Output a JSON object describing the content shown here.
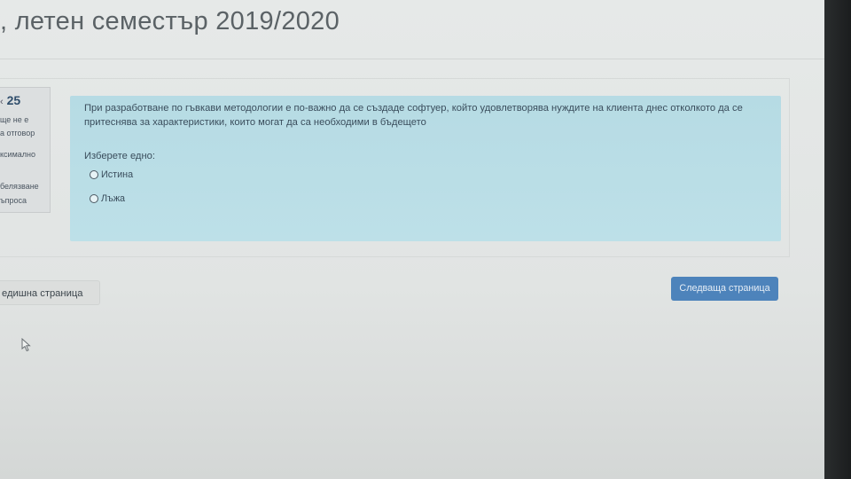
{
  "header": {
    "title": ", летен семестър 2019/2020"
  },
  "info": {
    "number_prefix": "‹",
    "number": "25",
    "lines": [
      "ще не е",
      "а отговор",
      "ксимално",
      "белязване",
      "ъпроса"
    ]
  },
  "question": {
    "text": "При разработване по гъвкави методологии е по-важно да се създаде софтуер, който удовлетворява нуждите на клиента днес отколкото да се притеснява за характеристики, които могат да са необходими в бъдещето",
    "prompt": "Изберете едно:",
    "options": [
      {
        "label": "Истина",
        "selected": false
      },
      {
        "label": "Лъжа",
        "selected": false
      }
    ]
  },
  "navigation": {
    "prev_label": "едишна страница",
    "next_label": "Следваща страница"
  },
  "colors": {
    "card_bg": "#b9dde6",
    "primary_button": "#4d83bb",
    "question_number": "#2f4d6b"
  }
}
